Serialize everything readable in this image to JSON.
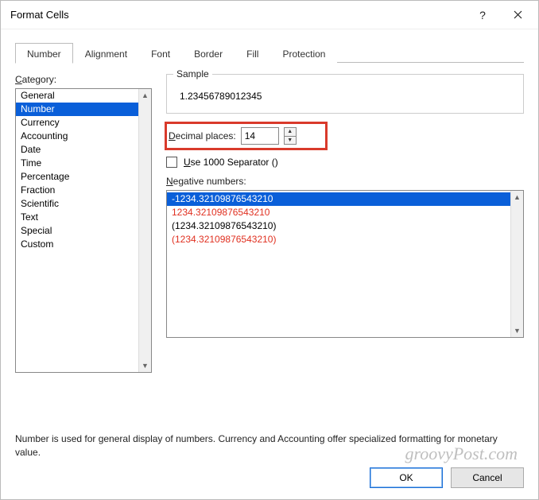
{
  "window": {
    "title": "Format Cells"
  },
  "tabs": {
    "items": [
      "Number",
      "Alignment",
      "Font",
      "Border",
      "Fill",
      "Protection"
    ],
    "active": 0
  },
  "category": {
    "label": "Category:",
    "items": [
      "General",
      "Number",
      "Currency",
      "Accounting",
      "Date",
      "Time",
      "Percentage",
      "Fraction",
      "Scientific",
      "Text",
      "Special",
      "Custom"
    ],
    "selected": 1
  },
  "sample": {
    "legend": "Sample",
    "value": "1.23456789012345"
  },
  "decimal": {
    "label_pre": "D",
    "label_post": "ecimal places:",
    "value": "14"
  },
  "separator": {
    "label_pre": "U",
    "label_post": "se 1000 Separator ()",
    "checked": false
  },
  "negative": {
    "label_pre": "N",
    "label_post": "egative numbers:",
    "items": [
      {
        "text": "-1234.32109876543210",
        "selected": true,
        "red": false
      },
      {
        "text": "1234.32109876543210",
        "selected": false,
        "red": true
      },
      {
        "text": "(1234.32109876543210)",
        "selected": false,
        "red": false
      },
      {
        "text": "(1234.32109876543210)",
        "selected": false,
        "red": true
      }
    ]
  },
  "description": "Number is used for general display of numbers.  Currency and Accounting offer specialized formatting for monetary value.",
  "buttons": {
    "ok": "OK",
    "cancel": "Cancel"
  },
  "watermark": "groovyPost.com"
}
